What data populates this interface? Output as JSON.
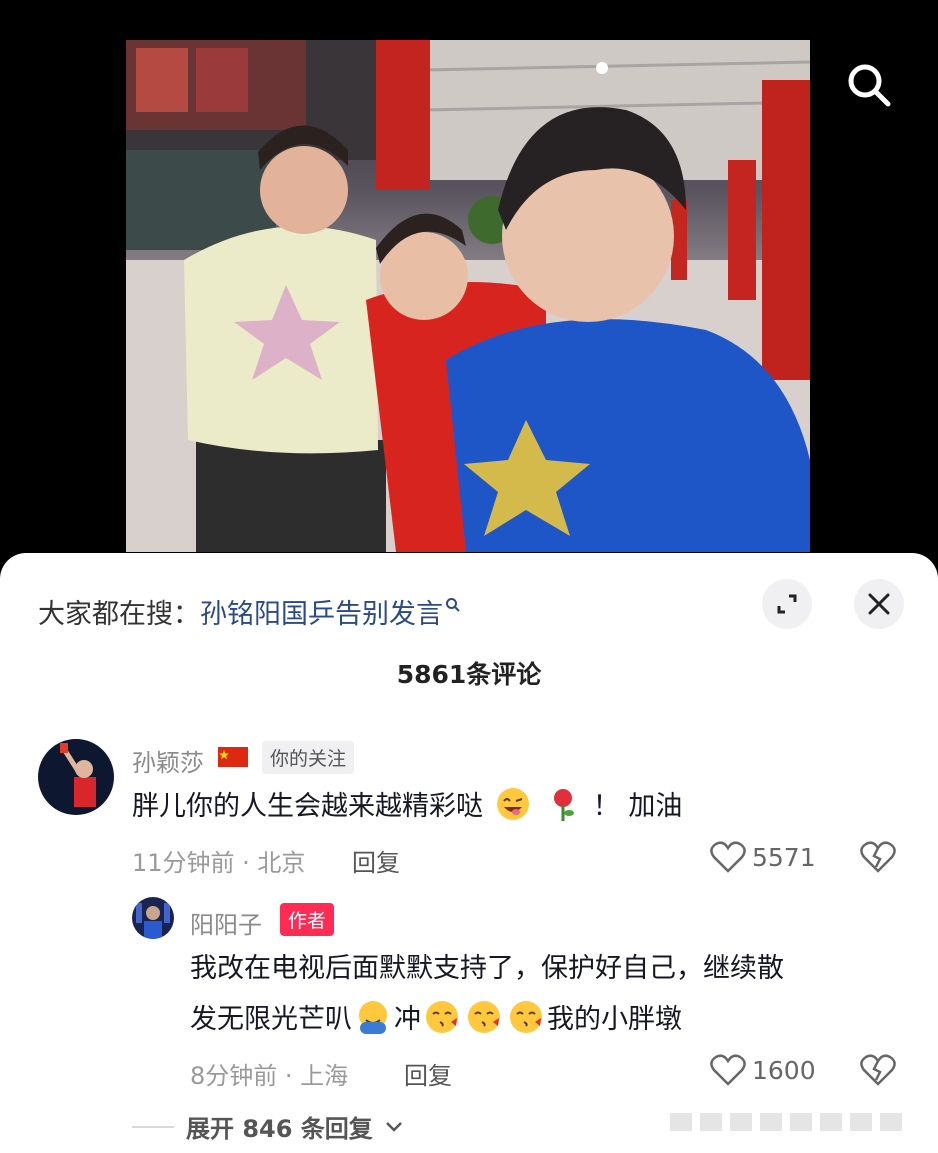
{
  "header": {
    "search_icon": "search-icon"
  },
  "trending": {
    "prefix": "大家都在搜：",
    "query": "孙铭阳国乒告别发言",
    "icon": "mini-search-icon"
  },
  "panel": {
    "expand_icon": "expand-icon",
    "close_icon": "close-icon",
    "comment_count": "5861条评论"
  },
  "comments": [
    {
      "username": "孙颖莎",
      "flag_icon": "china-flag-icon",
      "tag": "你的关注",
      "text_before": "胖儿你的人生会越来越精彩哒",
      "emoji": [
        "grinning-tongue-emoji",
        "rose-emoji"
      ],
      "text_after": "！ 加油",
      "time": "11分钟前 · 北京",
      "reply_label": "回复",
      "likes": "5571"
    }
  ],
  "replies": [
    {
      "username": "阳阳子",
      "tag": "作者",
      "line1": "我改在电视后面默默支持了，保护好自己，继续散",
      "line2_a": "发无限光芒叭",
      "line2_b": "冲",
      "line2_c": "我的小胖墩",
      "emoji": [
        "hug-emoji",
        "kiss-emoji",
        "kiss-emoji",
        "kiss-emoji"
      ],
      "time": "8分钟前 · 上海",
      "reply_label": "回复",
      "likes": "1600"
    }
  ],
  "expand_replies": {
    "label": "展开 846 条回复"
  },
  "colors": {
    "accent": "#fe2c55",
    "link": "#2a4a88"
  }
}
